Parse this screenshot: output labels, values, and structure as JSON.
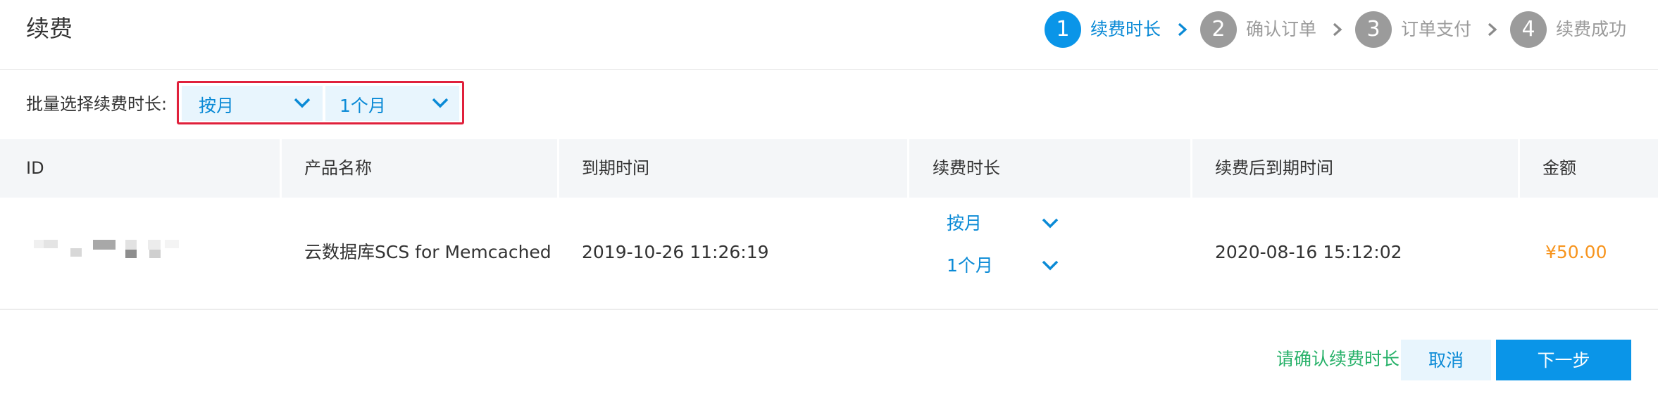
{
  "header": {
    "title": "续费"
  },
  "steps": [
    {
      "num": "1",
      "label": "续费时长",
      "active": true
    },
    {
      "num": "2",
      "label": "确认订单",
      "active": false
    },
    {
      "num": "3",
      "label": "订单支付",
      "active": false
    },
    {
      "num": "4",
      "label": "续费成功",
      "active": false
    }
  ],
  "batch": {
    "label": "批量选择续费时长:",
    "unit_value": "按月",
    "duration_value": "1个月"
  },
  "table": {
    "columns": [
      "ID",
      "产品名称",
      "到期时间",
      "续费时长",
      "续费后到期时间",
      "金额"
    ],
    "rows": [
      {
        "product": "云数据库SCS for Memcached",
        "expire": "2019-10-26 11:26:19",
        "unit": "按月",
        "duration": "1个月",
        "new_expire": "2020-08-16 15:12:02",
        "amount": "¥50.00"
      }
    ]
  },
  "footer": {
    "hint": "请确认续费时长",
    "cancel_label": "取消",
    "next_label": "下一步"
  },
  "colors": {
    "accent": "#0a95e8",
    "inactive_step": "#9b9b9b",
    "highlight_border": "#e0203b",
    "price": "#f7941d",
    "hint": "#27b169"
  },
  "icons": [
    "chevron-down-icon",
    "chevron-right-icon"
  ]
}
